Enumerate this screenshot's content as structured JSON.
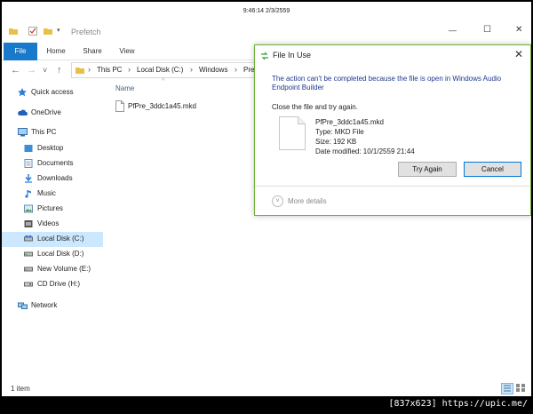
{
  "clock": "9:46:14 2/3/2559",
  "window": {
    "title": "Prefetch",
    "controls": {
      "minimize": "—",
      "maximize": "☐",
      "close": "✕"
    }
  },
  "ribbon": {
    "tabs": [
      "File",
      "Home",
      "Share",
      "View"
    ],
    "accent": "#1979ca"
  },
  "address": {
    "back": "←",
    "forward": "→",
    "recent": "˅",
    "up": "↑",
    "separator": "›",
    "crumbs": [
      "This PC",
      "Local Disk (C:)",
      "Windows",
      "Pref"
    ]
  },
  "sidebar": {
    "items": [
      {
        "label": "Quick access",
        "icon": "star-icon"
      },
      {
        "label": "OneDrive",
        "icon": "cloud-icon"
      },
      {
        "label": "This PC",
        "icon": "computer-icon"
      },
      {
        "label": "Desktop",
        "icon": "folder-icon"
      },
      {
        "label": "Documents",
        "icon": "folder-icon"
      },
      {
        "label": "Downloads",
        "icon": "download-icon"
      },
      {
        "label": "Music",
        "icon": "music-icon"
      },
      {
        "label": "Pictures",
        "icon": "folder-icon"
      },
      {
        "label": "Videos",
        "icon": "video-icon"
      },
      {
        "label": "Local Disk (C:)",
        "icon": "drive-icon",
        "selected": true
      },
      {
        "label": "Local Disk (D:)",
        "icon": "drive-icon"
      },
      {
        "label": "New Volume (E:)",
        "icon": "drive-icon"
      },
      {
        "label": "CD Drive (H:)",
        "icon": "cd-drive-icon"
      },
      {
        "label": "Network",
        "icon": "network-icon"
      }
    ],
    "selected_color": "#cce8ff"
  },
  "content": {
    "column_name": "Name",
    "files": [
      {
        "name": "PfPre_3ddc1a45.mkd"
      }
    ]
  },
  "status": {
    "text": "1 item"
  },
  "dialog": {
    "title": "File In Use",
    "close": "✕",
    "message": "The action can't be completed because the file is open in Windows Audio Endpoint Builder",
    "retry_text": "Close the file and try again.",
    "file_name": "PfPre_3ddc1a45.mkd",
    "file_type": "Type: MKD File",
    "file_size": "Size: 192 KB",
    "file_modified": "Date modified: 10/1/2559 21:44",
    "try_again": "Try Again",
    "cancel": "Cancel",
    "more_details": "More details",
    "expand": "˅",
    "border_color": "#6fb13a"
  },
  "watermark": "[837x623] https://upic.me/"
}
